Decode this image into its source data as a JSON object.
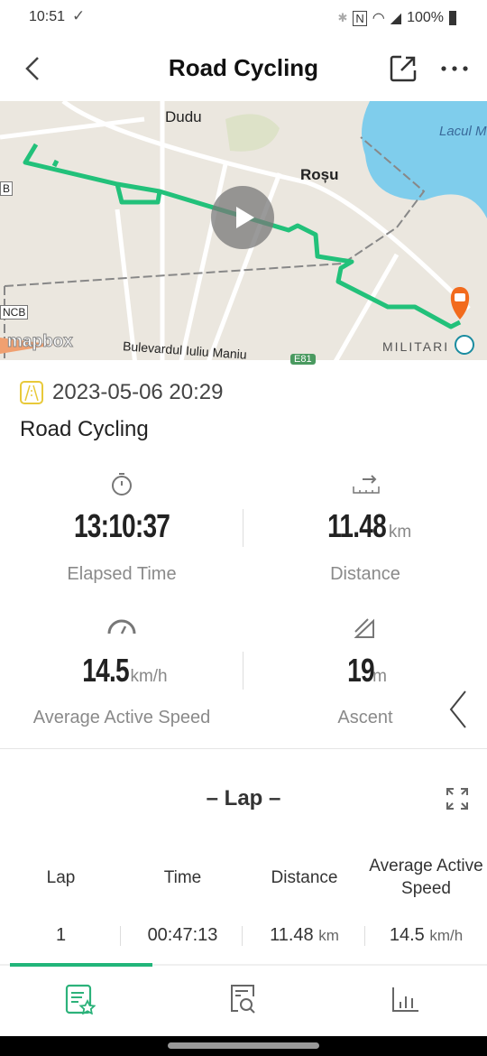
{
  "status_bar": {
    "time": "10:51",
    "battery": "100%"
  },
  "header": {
    "title": "Road Cycling",
    "back_icon": "chevron-left-icon",
    "share_icon": "share-icon",
    "more_icon": "more-icon"
  },
  "map": {
    "labels": {
      "dudu": "Dudu",
      "rosu": "Roșu",
      "lake": "Lacul M",
      "militari": "MILITARI",
      "boulevard": "Bulevardul Iuliu Maniu",
      "e81": "E81",
      "ncb": "NCB",
      "b": "B",
      "mapbox": "mapbox"
    },
    "route_color": "#22c17a",
    "marker_color": "#f26b1d"
  },
  "activity": {
    "datetime": "2023-05-06 20:29",
    "name": "Road Cycling",
    "badge_color": "#e8c93a"
  },
  "stats": [
    {
      "value": "13:10:37",
      "unit": "",
      "label": "Elapsed Time",
      "icon": "stopwatch-icon"
    },
    {
      "value": "11.48",
      "unit": "km",
      "label": "Distance",
      "icon": "ruler-icon"
    },
    {
      "value": "14.5",
      "unit": "km/h",
      "label": "Average Active Speed",
      "icon": "speedometer-icon"
    },
    {
      "value": "19",
      "unit": "m",
      "label": "Ascent",
      "icon": "slope-icon"
    }
  ],
  "lap": {
    "title": "Lap",
    "headers": [
      "Lap",
      "Time",
      "Distance",
      "Average Active Speed"
    ],
    "rows": [
      {
        "lap": "1",
        "time": "00:47:13",
        "distance": "11.48",
        "distance_unit": "km",
        "speed": "14.5",
        "speed_unit": "km/h"
      }
    ]
  },
  "accent": "#22b57a"
}
